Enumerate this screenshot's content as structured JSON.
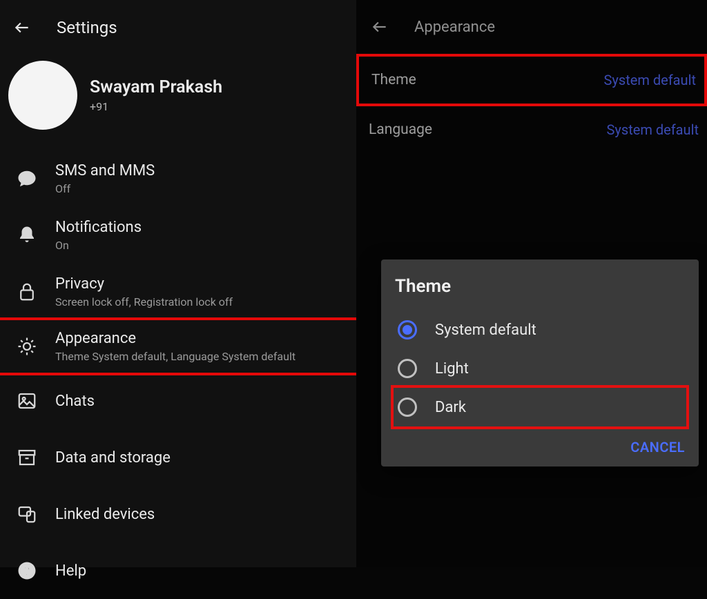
{
  "left": {
    "header_title": "Settings",
    "profile": {
      "name": "Swayam Prakash",
      "phone_prefix": "+91 "
    },
    "items": [
      {
        "title": "SMS and MMS",
        "sub": "Off"
      },
      {
        "title": "Notifications",
        "sub": "On"
      },
      {
        "title": "Privacy",
        "sub": "Screen lock off, Registration lock off"
      },
      {
        "title": "Appearance",
        "sub": "Theme System default, Language System default"
      },
      {
        "title": "Chats",
        "sub": ""
      },
      {
        "title": "Data and storage",
        "sub": ""
      },
      {
        "title": "Linked devices",
        "sub": ""
      },
      {
        "title": "Help",
        "sub": ""
      }
    ]
  },
  "right": {
    "header_title": "Appearance",
    "rows": [
      {
        "key": "Theme",
        "value": "System default",
        "highlighted": true
      },
      {
        "key": "Language",
        "value": "System default",
        "highlighted": false
      }
    ],
    "dialog": {
      "title": "Theme",
      "options": [
        {
          "label": "System default",
          "selected": true,
          "highlighted": false
        },
        {
          "label": "Light",
          "selected": false,
          "highlighted": false
        },
        {
          "label": "Dark",
          "selected": false,
          "highlighted": true
        }
      ],
      "cancel_label": "CANCEL"
    }
  }
}
